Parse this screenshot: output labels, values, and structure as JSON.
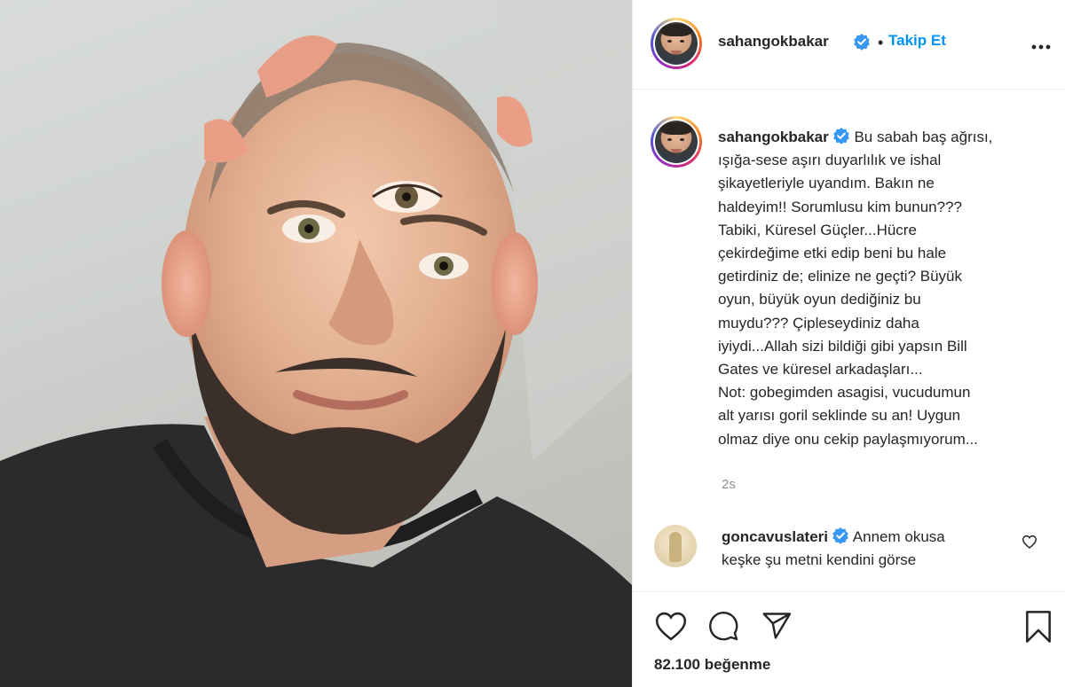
{
  "post": {
    "author": "sahangokbakar",
    "follow_label": "Takip Et",
    "follow_separator": "•",
    "caption_lines": [
      "Bu sabah baş ağrısı,",
      "ışığa-sese aşırı duyarlılık ve ishal",
      "şikayetleriyle uyandım. Bakın ne",
      "haldeyim!! Sorumlusu kim bunun???",
      "Tabiki, Küresel Güçler...Hücre",
      "çekirdeğime etki edip beni bu hale",
      "getirdiniz de; elinize ne geçti? Büyük",
      "oyun, büyük oyun dediğiniz bu",
      "muydu??? Çipleseydiniz daha",
      "iyiydi...Allah sizi bildiği gibi yapsın Bill",
      "Gates ve küresel arkadaşları...",
      "Not: gobegimden asagisi, vucudumun",
      "alt yarısı goril seklinde su an! Uygun",
      "olmaz diye onu cekip paylaşmıyorum..."
    ],
    "timestamp": "2s",
    "likes": "82.100 beğenme"
  },
  "comment": {
    "author": "goncavuslateri",
    "text_line1": "Annem okusa",
    "text_line2": "keşke şu metni kendini görse"
  },
  "icons": {
    "verified": "verified-badge-icon",
    "more": "more-options-icon",
    "like": "heart-icon",
    "comment": "comment-icon",
    "share": "send-icon",
    "save": "bookmark-icon"
  },
  "colors": {
    "link_blue": "#0095f6",
    "verified_blue": "#3897f0",
    "text": "#262626",
    "muted": "#8e8e8e"
  }
}
